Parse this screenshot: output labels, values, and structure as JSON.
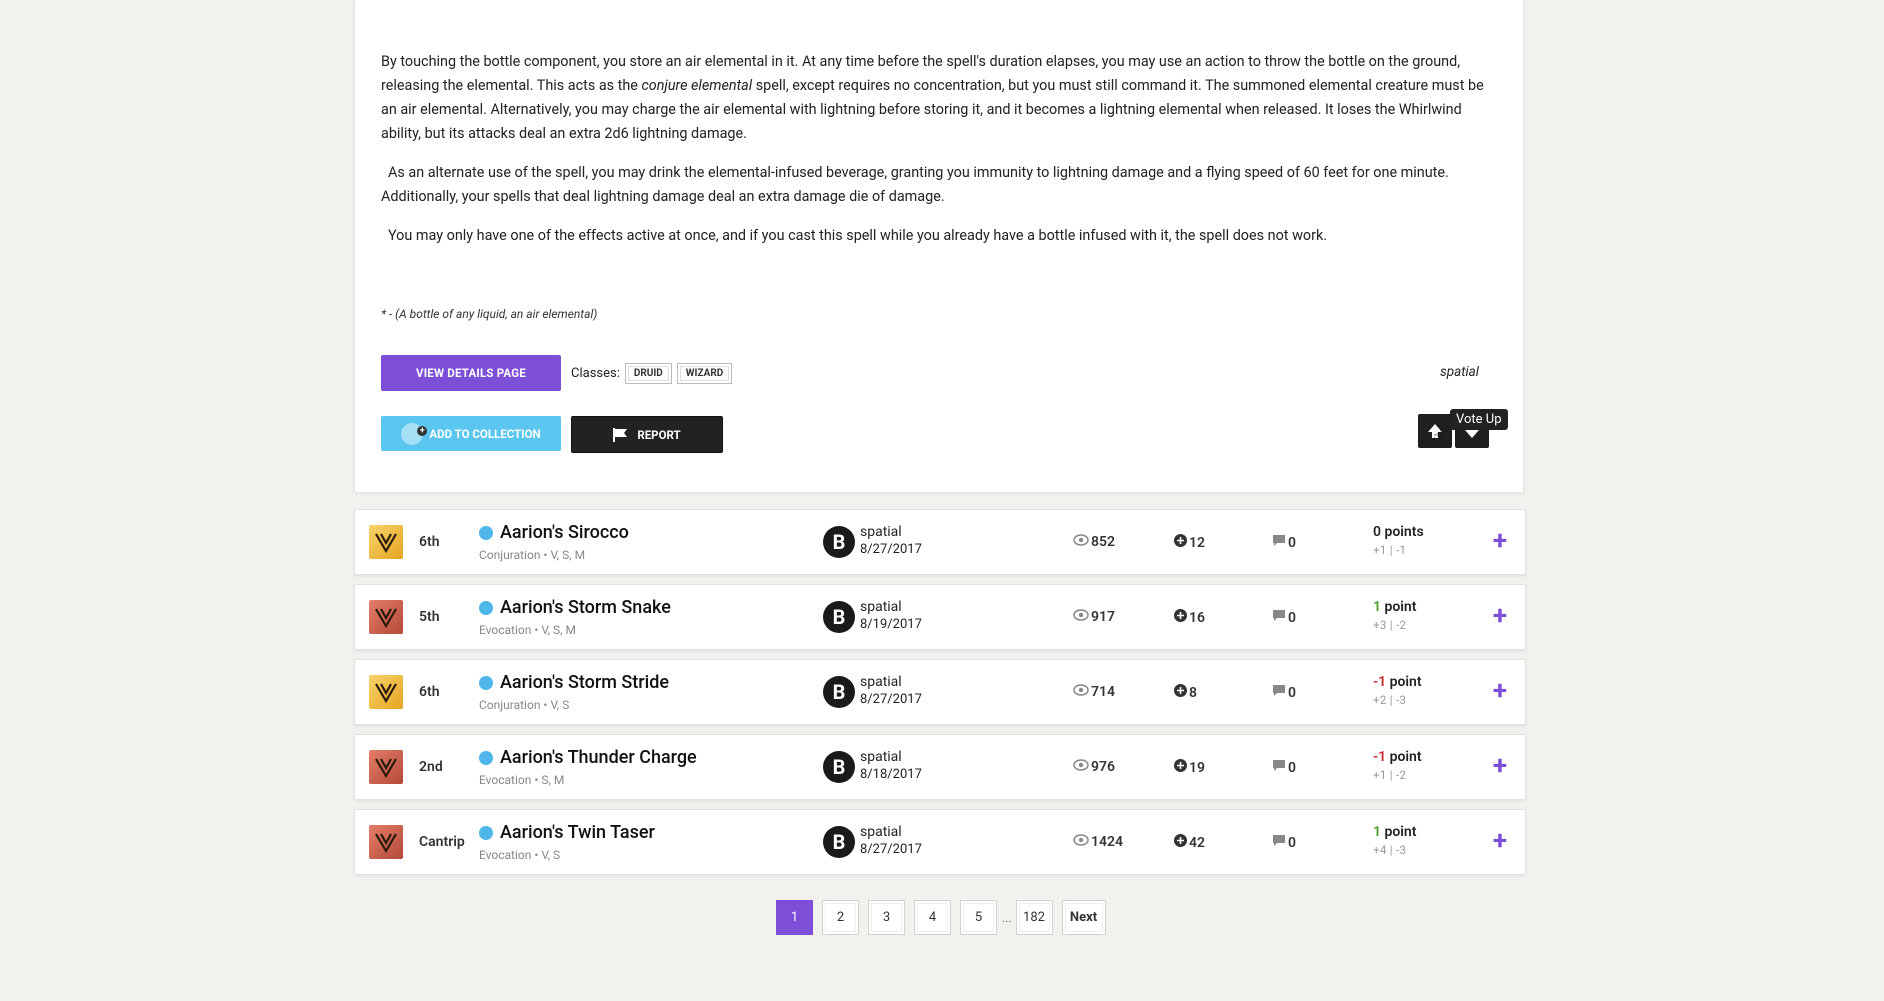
{
  "spell_detail": {
    "description_p1_a": "By touching the bottle component, you store an air elemental in it. At any time before the spell's duration elapses, you may use an action to throw the bottle on the ground, releasing the elemental. This acts as the ",
    "description_p1_em": "conjure elemental",
    "description_p1_b": " spell, except requires no concentration, but you must still command it. The summoned elemental creature must be an air elemental. Alternatively, you may charge the air elemental with lightning before storing it, and it becomes a lightning elemental when released. It loses the Whirlwind ability, but its attacks deal an extra 2d6 lightning damage.",
    "description_p2": "As an alternate use of the spell, you may drink the elemental-infused beverage, granting you immunity to lightning damage and a flying speed of 60 feet for one minute. Additionally, your spells that deal lightning damage deal an extra damage die of damage.",
    "description_p3": "You may only have one of the effects active at once, and if you cast this spell while you already have a bottle infused with it, the spell does not work.",
    "footnote": "* - (A bottle of any liquid, an air elemental)",
    "view_details_label": "VIEW DETAILS PAGE",
    "classes_label": "Classes:",
    "classes": [
      "DRUID",
      "WIZARD"
    ],
    "author": "spatial",
    "add_to_collection_label": "ADD TO COLLECTION",
    "report_label": "REPORT",
    "vote_up_tooltip": "Vote Up"
  },
  "spells": [
    {
      "school_icon": "conjuration-icon",
      "school_class": "conj",
      "level": "6th",
      "name": "Aarion's Sirocco",
      "meta": "Conjuration • V, S, M",
      "avatar": "B",
      "author": "spatial",
      "date": "8/27/2017",
      "views": "852",
      "adds": "12",
      "comments": "0",
      "points_num": "0",
      "points_word": "points",
      "points_sign": "zero",
      "breakdown": "+1 | -1"
    },
    {
      "school_icon": "evocation-icon",
      "school_class": "evoc",
      "level": "5th",
      "name": "Aarion's Storm Snake",
      "meta": "Evocation • V, S, M",
      "avatar": "B",
      "author": "spatial",
      "date": "8/19/2017",
      "views": "917",
      "adds": "16",
      "comments": "0",
      "points_num": "1",
      "points_word": "point",
      "points_sign": "pos",
      "breakdown": "+3 | -2"
    },
    {
      "school_icon": "conjuration-icon",
      "school_class": "conj",
      "level": "6th",
      "name": "Aarion's Storm Stride",
      "meta": "Conjuration • V, S",
      "avatar": "B",
      "author": "spatial",
      "date": "8/27/2017",
      "views": "714",
      "adds": "8",
      "comments": "0",
      "points_num": "-1",
      "points_word": "point",
      "points_sign": "neg",
      "breakdown": "+2 | -3"
    },
    {
      "school_icon": "evocation-icon",
      "school_class": "evoc",
      "level": "2nd",
      "name": "Aarion's Thunder Charge",
      "meta": "Evocation • S, M",
      "avatar": "B",
      "author": "spatial",
      "date": "8/18/2017",
      "views": "976",
      "adds": "19",
      "comments": "0",
      "points_num": "-1",
      "points_word": "point",
      "points_sign": "neg",
      "breakdown": "+1 | -2"
    },
    {
      "school_icon": "evocation-icon",
      "school_class": "evoc",
      "level": "Cantrip",
      "name": "Aarion's Twin Taser",
      "meta": "Evocation • V, S",
      "avatar": "B",
      "author": "spatial",
      "date": "8/27/2017",
      "views": "1424",
      "adds": "42",
      "comments": "0",
      "points_num": "1",
      "points_word": "point",
      "points_sign": "pos",
      "breakdown": "+4 | -3"
    }
  ],
  "pagination": {
    "pages": [
      "1",
      "2",
      "3",
      "4",
      "5"
    ],
    "ellipsis": "...",
    "last": "182",
    "next": "Next",
    "current": "1"
  },
  "colors": {
    "accent": "#7d4fd9",
    "collection": "#5bc6f0",
    "positive": "#4b9e2a",
    "negative": "#c62828"
  }
}
